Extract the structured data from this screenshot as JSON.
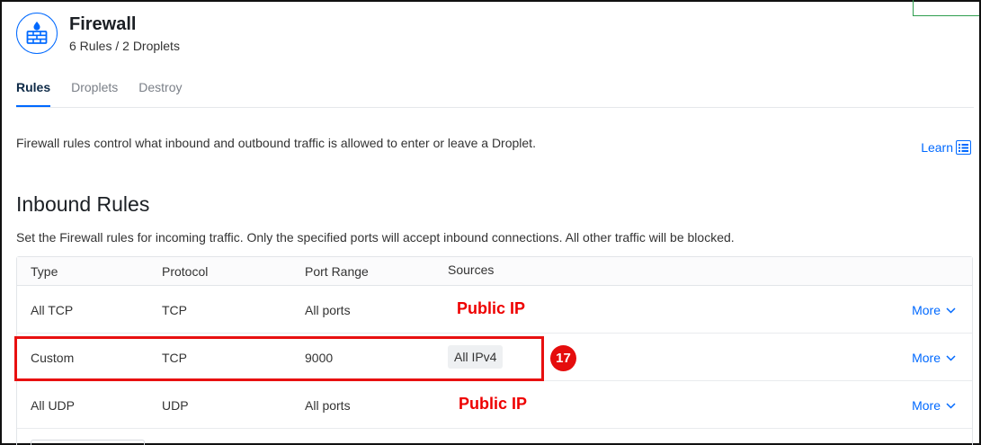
{
  "header": {
    "title": "Firewall",
    "subtitle": "6 Rules / 2 Droplets",
    "icon": "firewall-icon"
  },
  "tabs": [
    {
      "label": "Rules",
      "active": true
    },
    {
      "label": "Droplets",
      "active": false
    },
    {
      "label": "Destroy",
      "active": false
    }
  ],
  "description": "Firewall rules control what inbound and outbound traffic is allowed to enter or leave a Droplet.",
  "learn": {
    "label": "Learn",
    "icon": "book-icon"
  },
  "inbound": {
    "title": "Inbound Rules",
    "description": "Set the Firewall rules for incoming traffic. Only the specified ports will accept inbound connections. All other traffic will be blocked.",
    "columns": [
      "Type",
      "Protocol",
      "Port Range",
      "Sources"
    ],
    "rows": [
      {
        "type": "All TCP",
        "protocol": "TCP",
        "port_range": "All ports",
        "source": "Public IP",
        "action": "More"
      },
      {
        "type": "Custom",
        "protocol": "TCP",
        "port_range": "9000",
        "source": "All IPv4",
        "action": "More"
      },
      {
        "type": "All UDP",
        "protocol": "UDP",
        "port_range": "All ports",
        "source": "Public IP",
        "action": "More"
      }
    ]
  },
  "annotation": {
    "step_number": "17"
  },
  "colors": {
    "accent": "#0069ff",
    "annotation_red": "#e81010",
    "public_ip_red": "#ee0000"
  }
}
